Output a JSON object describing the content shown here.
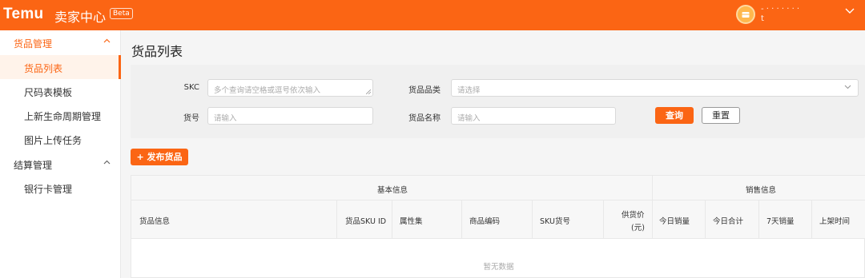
{
  "header": {
    "logo": "Temu",
    "app_title": "卖家中心",
    "beta": "Beta",
    "user_line1": "- · · · · · · ·",
    "user_line2": "t"
  },
  "sidebar": {
    "groups": [
      {
        "label": "货品管理",
        "items": [
          "货品列表",
          "尺码表模板",
          "上新生命周期管理",
          "图片上传任务"
        ]
      },
      {
        "label": "结算管理",
        "items": [
          "银行卡管理"
        ]
      }
    ]
  },
  "page": {
    "title": "货品列表"
  },
  "filters": {
    "skc_label": "SKC",
    "skc_placeholder": "多个查询请空格或逗号依次输入",
    "category_label": "货品品类",
    "category_placeholder": "请选择",
    "item_no_label": "货号",
    "item_no_placeholder": "请输入",
    "name_label": "货品名称",
    "name_placeholder": "请输入",
    "query": "查询",
    "reset": "重置"
  },
  "actions": {
    "publish": "+ 发布货品"
  },
  "table": {
    "groups": [
      "基本信息",
      "销售信息"
    ],
    "columns": [
      "货品信息",
      "货品SKU ID",
      "属性集",
      "商品编码",
      "SKU货号",
      "供货价",
      "(元)",
      "今日销量",
      "今日合计",
      "7天销量",
      "上架时间"
    ],
    "empty": "暂无数据"
  },
  "colors": {
    "brand": "#fb6514"
  }
}
